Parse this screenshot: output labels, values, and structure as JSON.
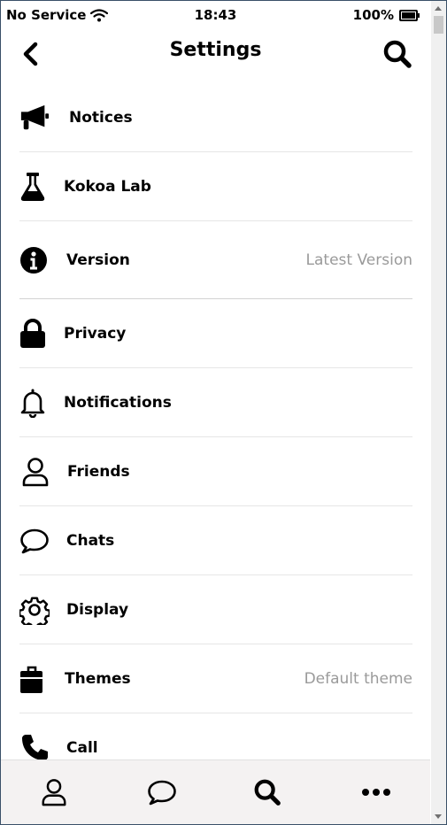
{
  "status_bar": {
    "carrier": "No Service",
    "time": "18:43",
    "battery": "100%"
  },
  "header": {
    "title": "Settings"
  },
  "settings": [
    {
      "icon": "megaphone-icon",
      "label": "Notices",
      "value": ""
    },
    {
      "icon": "flask-icon",
      "label": "Kokoa Lab",
      "value": ""
    },
    {
      "icon": "info-icon",
      "label": "Version",
      "value": "Latest Version"
    },
    {
      "icon": "lock-icon",
      "label": "Privacy",
      "value": ""
    },
    {
      "icon": "bell-icon",
      "label": "Notifications",
      "value": ""
    },
    {
      "icon": "user-icon",
      "label": "Friends",
      "value": ""
    },
    {
      "icon": "chat-bubble-icon",
      "label": "Chats",
      "value": ""
    },
    {
      "icon": "gear-icon",
      "label": "Display",
      "value": ""
    },
    {
      "icon": "briefcase-icon",
      "label": "Themes",
      "value": "Default theme"
    },
    {
      "icon": "phone-icon",
      "label": "Call",
      "value": ""
    }
  ],
  "tab_bar": [
    {
      "icon": "user-icon"
    },
    {
      "icon": "chat-bubble-icon"
    },
    {
      "icon": "search-icon"
    },
    {
      "icon": "more-icon"
    }
  ]
}
